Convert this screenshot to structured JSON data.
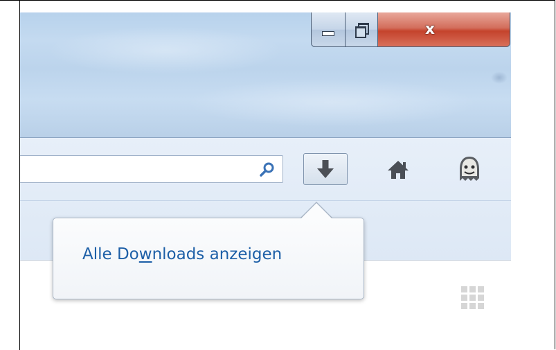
{
  "window_controls": {
    "minimize": "minimize",
    "maximize": "restore",
    "close_glyph": "x"
  },
  "toolbar": {
    "search": {
      "value": "",
      "icon": "search-icon"
    },
    "downloads_button": {
      "icon": "download-arrow-icon",
      "state": "pressed"
    },
    "home_button": {
      "icon": "home-icon"
    },
    "addon_button": {
      "icon": "ghost-icon"
    }
  },
  "downloads_panel": {
    "items": [
      {
        "label_before": "Alle Do",
        "label_accesskey": "w",
        "label_after": "nloads anzeigen"
      }
    ]
  },
  "content": {
    "menu_icon": "grid-icon"
  },
  "colors": {
    "link_blue": "#1d5fa7",
    "titlebar": "#c4daf0",
    "close_red": "#c4432c"
  }
}
